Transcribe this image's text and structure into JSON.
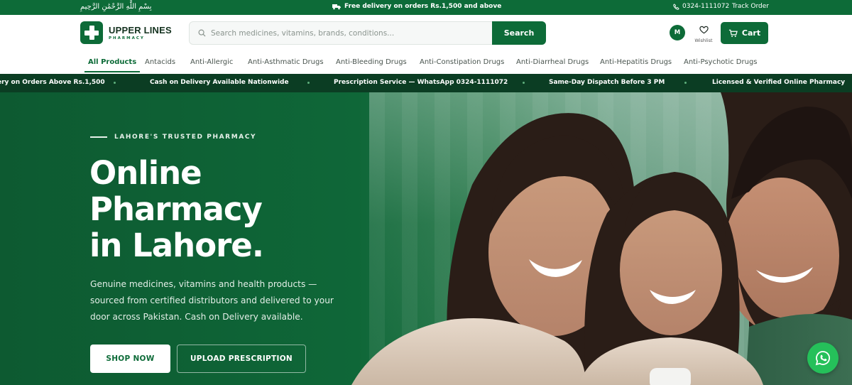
{
  "topbar": {
    "bismillah": "بِسْمِ اللَّهِ الرَّحْمَٰنِ الرَّحِيمِ",
    "promo": "Free delivery on orders Rs.1,500 and above",
    "phone": "0324-1111072",
    "track_order": "Track Order",
    "icons": {
      "promo": "truck-icon",
      "phone": "phone-icon"
    }
  },
  "header": {
    "logo_name": "UPPER LINES",
    "logo_sub": "PHARMACY",
    "search_placeholder": "Search medicines, vitamins, brands, conditions...",
    "search_value": "",
    "search_button": "Search",
    "avatar_initial": "M",
    "wishlist_label": "Wishlist",
    "cart_label": "Cart"
  },
  "categories": [
    {
      "label": "All Products",
      "active": true
    },
    {
      "label": "Antacids"
    },
    {
      "label": "Anti-Allergic"
    },
    {
      "label": "Anti-Asthmatic Drugs"
    },
    {
      "label": "Anti-Bleeding Drugs"
    },
    {
      "label": "Anti-Constipation Drugs"
    },
    {
      "label": "Anti-Diarrheal Drugs"
    },
    {
      "label": "Anti-Hepatitis Drugs"
    },
    {
      "label": "Anti-Psychotic Drugs"
    }
  ],
  "ticker": [
    "ery on Orders Above Rs.1,500",
    "Cash on Delivery Available Nationwide",
    "Prescription Service — WhatsApp 0324-1111072",
    "Same-Day Dispatch Before 3 PM",
    "Licensed & Verified Online Pharmacy"
  ],
  "hero": {
    "eyebrow": "LAHORE'S TRUSTED PHARMACY",
    "title_lines": [
      "Online",
      "Pharmacy",
      "in Lahore."
    ],
    "lead": "Genuine medicines, vitamins and health products — sourced from certified distributors and delivered to your door across Pakistan. Cash on Delivery available.",
    "shop_now": "SHOP NOW",
    "upload_prescription": "UPLOAD PRESCRIPTION"
  },
  "colors": {
    "brand": "#0d6b38",
    "ticker_bg": "#0b3d23",
    "whatsapp": "#25c05a"
  }
}
